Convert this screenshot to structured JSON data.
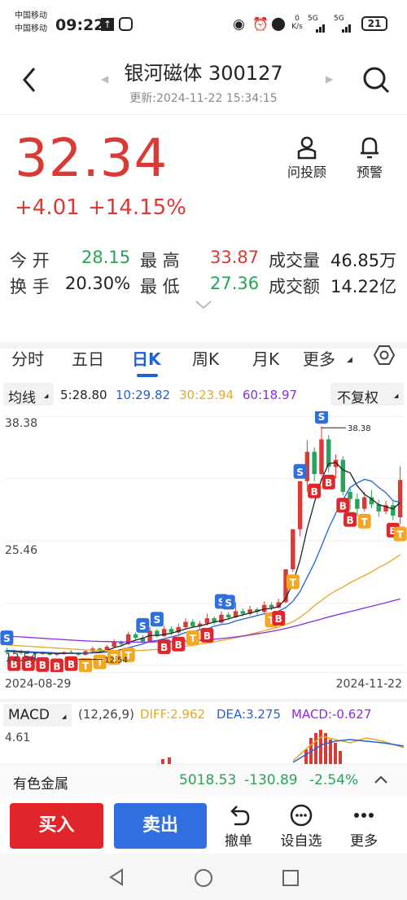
{
  "status": {
    "carrier1": "中国移动",
    "carrier2": "中国移动",
    "time": "09:22",
    "net": "0 K/s",
    "sig1": "5G",
    "sig2": "5G",
    "battery": "21"
  },
  "header": {
    "title": "银河磁体 300127",
    "updated": "更新:2024-11-22 15:34:15"
  },
  "quote": {
    "price": "32.34",
    "change": "+4.01",
    "change_pct": "+14.15%"
  },
  "tools": [
    {
      "icon": "advisor-icon",
      "label": "问投顾"
    },
    {
      "icon": "bell-icon",
      "label": "预警"
    }
  ],
  "stats": {
    "open_label": "今  开",
    "open": "28.15",
    "high_label": "最  高",
    "high": "33.87",
    "vol_label": "成交量",
    "vol": "46.85万",
    "turn_label": "换  手",
    "turn": "20.30%",
    "low_label": "最  低",
    "low": "27.36",
    "amt_label": "成交额",
    "amt": "14.22亿"
  },
  "tabs": [
    "分时",
    "五日",
    "日K",
    "周K",
    "月K",
    "更多"
  ],
  "ma": {
    "label": "均线",
    "ma5": "5:28.80",
    "ma10": "10:29.82",
    "ma30": "30:23.94",
    "ma60": "60:18.97",
    "adjust": "不复权"
  },
  "chart_data": {
    "type": "candlestick",
    "x_start": "2024-08-29",
    "x_end": "2024-11-22",
    "y_labels": [
      "38.38",
      "25.46",
      "12.54"
    ],
    "max_label": "38.38",
    "min_label": "12.54",
    "colors": {
      "up": "#d93a36",
      "down": "#27a35a",
      "ma5": "#222222",
      "ma10": "#1e63d6",
      "ma30": "#e8a723",
      "ma60": "#8a2be2"
    },
    "candles": [
      [
        13.2,
        13.0,
        12.9,
        13.5
      ],
      [
        13.0,
        13.1,
        12.8,
        13.3
      ],
      [
        13.1,
        12.9,
        12.7,
        13.3
      ],
      [
        12.9,
        13.0,
        12.8,
        13.2
      ],
      [
        13.0,
        12.8,
        12.6,
        13.1
      ],
      [
        12.8,
        12.9,
        12.7,
        13.0
      ],
      [
        12.9,
        12.7,
        12.6,
        13.0
      ],
      [
        12.7,
        12.8,
        12.55,
        12.9
      ],
      [
        12.8,
        13.0,
        12.7,
        13.1
      ],
      [
        13.0,
        12.9,
        12.8,
        13.2
      ],
      [
        12.9,
        12.7,
        12.54,
        13.0
      ],
      [
        12.7,
        13.1,
        12.6,
        13.2
      ],
      [
        13.1,
        13.4,
        13.0,
        13.6
      ],
      [
        13.4,
        13.2,
        13.0,
        13.5
      ],
      [
        13.2,
        13.6,
        13.1,
        13.8
      ],
      [
        13.6,
        14.2,
        13.5,
        14.4
      ],
      [
        14.2,
        13.9,
        13.7,
        14.3
      ],
      [
        13.9,
        15.0,
        13.8,
        15.3
      ],
      [
        15.0,
        14.6,
        14.3,
        15.2
      ],
      [
        14.6,
        14.2,
        14.0,
        14.9
      ],
      [
        14.2,
        15.4,
        14.1,
        15.8
      ],
      [
        15.4,
        14.8,
        14.6,
        15.6
      ],
      [
        14.8,
        15.6,
        14.7,
        16.0
      ],
      [
        15.6,
        15.2,
        14.9,
        15.9
      ],
      [
        15.2,
        15.8,
        15.0,
        16.2
      ],
      [
        15.8,
        16.4,
        15.6,
        16.8
      ],
      [
        16.4,
        15.9,
        15.7,
        16.7
      ],
      [
        15.9,
        16.2,
        15.6,
        16.5
      ],
      [
        16.2,
        16.8,
        16.0,
        17.3
      ],
      [
        16.8,
        16.3,
        16.1,
        17.0
      ],
      [
        16.3,
        17.2,
        16.2,
        17.6
      ],
      [
        17.2,
        16.9,
        16.6,
        17.5
      ],
      [
        16.9,
        17.6,
        16.8,
        18.6
      ],
      [
        17.6,
        17.3,
        17.0,
        17.9
      ],
      [
        17.3,
        17.8,
        17.1,
        18.2
      ],
      [
        17.8,
        17.5,
        17.2,
        18.0
      ],
      [
        17.5,
        18.3,
        17.4,
        18.7
      ],
      [
        18.3,
        18.0,
        17.7,
        18.6
      ],
      [
        18.0,
        18.6,
        17.9,
        19.0
      ],
      [
        18.6,
        22.3,
        18.5,
        22.3
      ],
      [
        22.3,
        26.8,
        22.0,
        26.8
      ],
      [
        26.8,
        32.2,
        26.0,
        32.2
      ],
      [
        32.2,
        35.5,
        31.0,
        36.8
      ],
      [
        35.5,
        33.0,
        32.2,
        36.0
      ],
      [
        33.0,
        36.9,
        32.8,
        38.38
      ],
      [
        36.9,
        33.8,
        33.2,
        37.4
      ],
      [
        33.8,
        34.6,
        32.5,
        35.2
      ],
      [
        34.6,
        31.0,
        30.6,
        35.0
      ],
      [
        31.0,
        30.2,
        29.0,
        31.6
      ],
      [
        30.2,
        29.1,
        28.3,
        30.8
      ],
      [
        29.1,
        30.4,
        28.8,
        31.0
      ],
      [
        30.4,
        29.6,
        29.2,
        31.2
      ],
      [
        29.6,
        28.8,
        28.2,
        30.1
      ],
      [
        28.8,
        29.5,
        28.5,
        30.0
      ],
      [
        29.5,
        28.33,
        27.8,
        29.9
      ],
      [
        28.15,
        32.34,
        27.36,
        33.87
      ]
    ],
    "ma5": [
      13.1,
      13.05,
      13.0,
      12.98,
      12.96,
      12.9,
      12.88,
      12.84,
      12.83,
      12.86,
      12.84,
      12.86,
      12.96,
      13.02,
      13.18,
      13.5,
      13.7,
      14.06,
      14.34,
      14.56,
      14.86,
      14.86,
      14.98,
      15.12,
      15.36,
      15.6,
      15.8,
      15.94,
      16.14,
      16.38,
      16.52,
      16.74,
      16.98,
      17.18,
      17.38,
      17.6,
      17.84,
      17.9,
      18.1,
      19.02,
      20.8,
      23.34,
      26.86,
      29.78,
      32.4,
      34.16,
      34.3,
      33.46,
      33.14,
      31.68,
      30.74,
      30.2,
      29.56,
      29.34,
      29.08,
      29.8
    ],
    "ma10": [
      13.2,
      13.15,
      13.1,
      13.05,
      13.0,
      12.98,
      12.95,
      12.9,
      12.9,
      12.89,
      12.88,
      12.87,
      12.9,
      12.92,
      13.0,
      13.1,
      13.3,
      13.5,
      13.7,
      13.9,
      14.2,
      14.3,
      14.5,
      14.7,
      14.9,
      15.2,
      15.3,
      15.5,
      15.6,
      15.9,
      16.1,
      16.2,
      16.5,
      16.7,
      16.9,
      17.1,
      17.3,
      17.4,
      17.6,
      18.0,
      18.7,
      19.8,
      21.4,
      23.0,
      24.9,
      26.9,
      28.6,
      30.1,
      31.5,
      32.0,
      32.4,
      32.2,
      31.5,
      30.9,
      30.0,
      29.82
    ],
    "ma30": [
      13.8,
      13.75,
      13.7,
      13.65,
      13.6,
      13.55,
      13.5,
      13.45,
      13.4,
      13.35,
      13.3,
      13.25,
      13.22,
      13.2,
      13.18,
      13.17,
      13.16,
      13.16,
      13.17,
      13.2,
      13.25,
      13.3,
      13.38,
      13.45,
      13.55,
      13.65,
      13.75,
      13.9,
      14.0,
      14.15,
      14.3,
      14.45,
      14.6,
      14.8,
      15.0,
      15.2,
      15.4,
      15.6,
      15.8,
      16.1,
      16.4,
      16.9,
      17.5,
      18.2,
      18.8,
      19.4,
      19.9,
      20.3,
      20.8,
      21.2,
      21.6,
      22.0,
      22.5,
      22.9,
      23.4,
      23.94
    ],
    "ma60": [
      14.8,
      14.75,
      14.7,
      14.65,
      14.6,
      14.55,
      14.5,
      14.45,
      14.4,
      14.35,
      14.3,
      14.26,
      14.22,
      14.2,
      14.18,
      14.16,
      14.14,
      14.13,
      14.12,
      14.12,
      14.13,
      14.14,
      14.16,
      14.18,
      14.2,
      14.23,
      14.27,
      14.32,
      14.38,
      14.45,
      14.52,
      14.6,
      14.7,
      14.8,
      14.92,
      15.05,
      15.18,
      15.32,
      15.48,
      15.65,
      15.85,
      16.05,
      16.28,
      16.5,
      16.72,
      16.95,
      17.15,
      17.35,
      17.55,
      17.75,
      17.95,
      18.15,
      18.35,
      18.55,
      18.76,
      18.97
    ],
    "markers": [
      {
        "i": 0,
        "t": "S",
        "c": "#2f6fe0"
      },
      {
        "i": 1,
        "t": "B",
        "c": "#e0252b"
      },
      {
        "i": 3,
        "t": "B",
        "c": "#e0252b"
      },
      {
        "i": 5,
        "t": "B",
        "c": "#e0252b"
      },
      {
        "i": 7,
        "t": "B",
        "c": "#e0252b"
      },
      {
        "i": 9,
        "t": "B",
        "c": "#e0252b"
      },
      {
        "i": 11,
        "t": "T",
        "c": "#f5a623"
      },
      {
        "i": 13,
        "t": "T",
        "c": "#f5a623"
      },
      {
        "i": 15,
        "t": "T",
        "c": "#f5a623"
      },
      {
        "i": 17,
        "t": "T",
        "c": "#f5a623"
      },
      {
        "i": 19,
        "t": "S",
        "c": "#2f6fe0"
      },
      {
        "i": 21,
        "t": "S",
        "c": "#2f6fe0"
      },
      {
        "i": 22,
        "t": "B",
        "c": "#e0252b"
      },
      {
        "i": 24,
        "t": "B",
        "c": "#e0252b"
      },
      {
        "i": 26,
        "t": "T",
        "c": "#f5a623"
      },
      {
        "i": 28,
        "t": "B",
        "c": "#e0252b"
      },
      {
        "i": 30,
        "t": "S",
        "c": "#2f6fe0"
      },
      {
        "i": 31,
        "t": "S",
        "c": "#2f6fe0"
      },
      {
        "i": 37,
        "t": "T",
        "c": "#f5a623"
      },
      {
        "i": 38,
        "t": "B",
        "c": "#e0252b"
      },
      {
        "i": 40,
        "t": "T",
        "c": "#f5a623"
      },
      {
        "i": 41,
        "t": "S",
        "c": "#2f6fe0"
      },
      {
        "i": 43,
        "t": "B",
        "c": "#e0252b"
      },
      {
        "i": 44,
        "t": "S",
        "c": "#2f6fe0"
      },
      {
        "i": 45,
        "t": "B",
        "c": "#e0252b"
      },
      {
        "i": 47,
        "t": "B",
        "c": "#e0252b"
      },
      {
        "i": 48,
        "t": "B",
        "c": "#e0252b"
      },
      {
        "i": 50,
        "t": "T",
        "c": "#f5a623"
      },
      {
        "i": 54,
        "t": "B",
        "c": "#e0252b"
      },
      {
        "i": 55,
        "t": "T",
        "c": "#f5a623"
      }
    ],
    "ylim": [
      11.5,
      39.5
    ]
  },
  "dates": {
    "start": "2024-08-29",
    "end": "2024-11-22"
  },
  "macd": {
    "label": "MACD",
    "params": "(12,26,9)",
    "diff": "DIFF:2.962",
    "dea": "DEA:3.275",
    "macd": "MACD:-0.627",
    "top": "4.61"
  },
  "sector": {
    "name": "有色金属",
    "value": "5018.53",
    "change": "-130.89",
    "pct": "-2.54%"
  },
  "actions": {
    "buy": "买入",
    "sell": "卖出",
    "cancel": "撤单",
    "watch": "设自选",
    "more": "更多"
  }
}
